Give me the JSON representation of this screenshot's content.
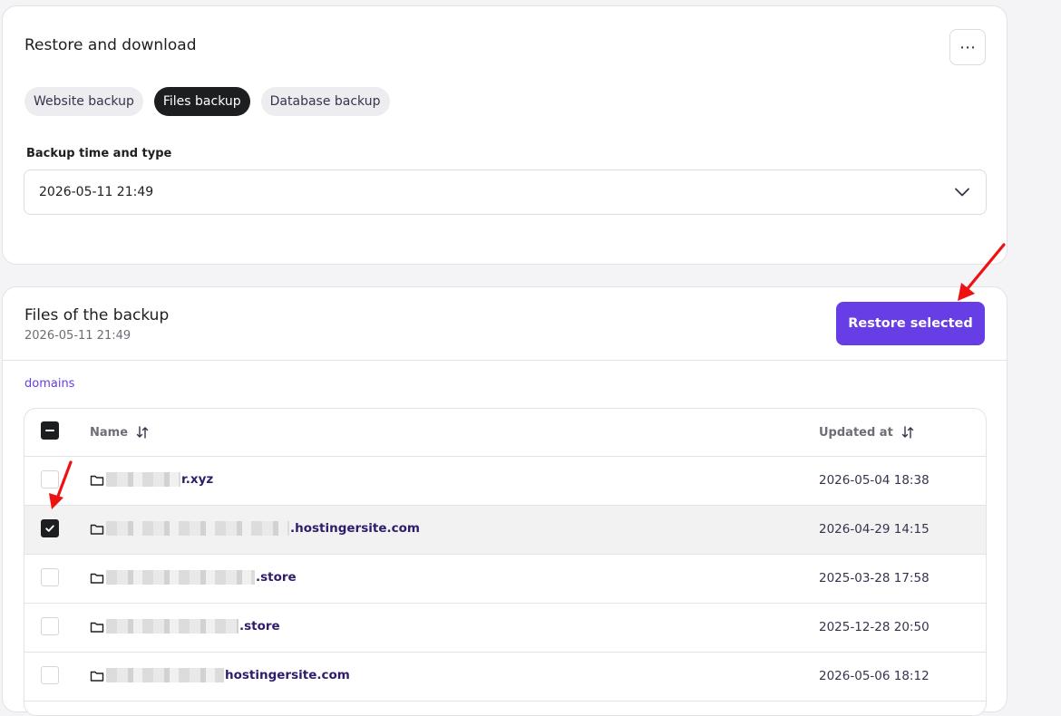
{
  "restore_card": {
    "title": "Restore and download",
    "more_label": "⋯",
    "tabs": [
      {
        "label": "Website backup",
        "active": false
      },
      {
        "label": "Files backup",
        "active": true
      },
      {
        "label": "Database backup",
        "active": false
      }
    ],
    "field_label": "Backup time and type",
    "selected_backup": "2026-05-11 21:49"
  },
  "files_card": {
    "title": "Files of the backup",
    "subtitle": "2026-05-11 21:49",
    "restore_button": "Restore selected",
    "breadcrumb": "domains",
    "columns": {
      "name": "Name",
      "updated": "Updated at"
    },
    "rows": [
      {
        "name_suffix": "r.xyz",
        "updated": "2026-05-04 18:38",
        "checked": false
      },
      {
        "name_suffix": ".hostingersite.com",
        "updated": "2026-04-29 14:15",
        "checked": true
      },
      {
        "name_suffix": ".store",
        "updated": "2025-03-28 17:58",
        "checked": false
      },
      {
        "name_suffix": ".store",
        "updated": "2025-12-28 20:50",
        "checked": false
      },
      {
        "name_suffix": "hostingersite.com",
        "updated": "2026-05-06 18:12",
        "checked": false
      }
    ]
  },
  "colors": {
    "accent": "#673de6",
    "dark": "#1d1e20",
    "annotation_arrow": "#ee1111"
  }
}
